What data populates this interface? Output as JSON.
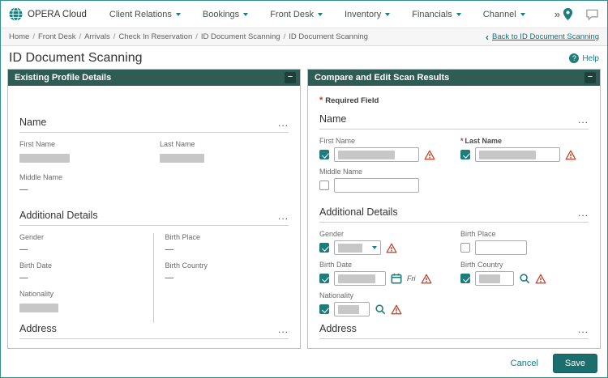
{
  "ui": {
    "ellipsis": "...",
    "collapse": "−",
    "required_glyph": "*",
    "back_chevron": "‹",
    "more": "»",
    "help_glyph": "?"
  },
  "topnav": {
    "brand": "OPERA Cloud",
    "items": [
      "Client Relations",
      "Bookings",
      "Front Desk",
      "Inventory",
      "Financials",
      "Channel"
    ]
  },
  "breadcrumb": {
    "items": [
      "Home",
      "Front Desk",
      "Arrivals",
      "Check In Reservation",
      "ID Document Scanning",
      "ID Document Scanning"
    ],
    "separator": "/",
    "back": "Back to ID Document Scanning"
  },
  "page": {
    "title": "ID Document Scanning",
    "help": "Help"
  },
  "left_panel": {
    "title": "Existing Profile Details",
    "name": {
      "heading": "Name",
      "first_name_label": "First Name",
      "last_name_label": "Last Name",
      "middle_name_label": "Middle Name",
      "middle_name_value": "—"
    },
    "details": {
      "heading": "Additional Details",
      "gender_label": "Gender",
      "gender_value": "—",
      "birth_date_label": "Birth Date",
      "birth_date_value": "—",
      "nationality_label": "Nationality",
      "birth_place_label": "Birth Place",
      "birth_place_value": "—",
      "birth_country_label": "Birth Country",
      "birth_country_value": "—"
    },
    "address": {
      "heading": "Address"
    }
  },
  "right_panel": {
    "title": "Compare and Edit Scan Results",
    "required_note": "Required Field",
    "name": {
      "heading": "Name",
      "first_name_label": "First Name",
      "last_name_label": "Last Name",
      "middle_name_label": "Middle Name"
    },
    "details": {
      "heading": "Additional Details",
      "gender_label": "Gender",
      "birth_place_label": "Birth Place",
      "birth_date_label": "Birth Date",
      "birth_date_day": "Fri",
      "birth_country_label": "Birth Country",
      "nationality_label": "Nationality"
    },
    "address": {
      "heading": "Address"
    }
  },
  "footer": {
    "cancel": "Cancel",
    "save": "Save"
  }
}
